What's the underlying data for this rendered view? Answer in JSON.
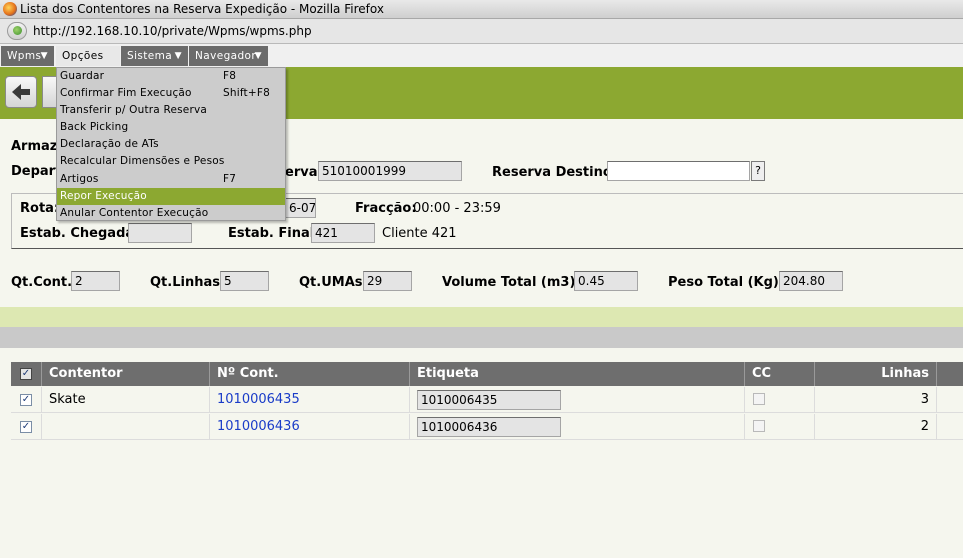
{
  "window": {
    "title": "Lista dos Contentores na Reserva Expedição - Mozilla Firefox",
    "url": "http://192.168.10.10/private/Wpms/wpms.php"
  },
  "menubar": [
    {
      "label": "Wpms"
    },
    {
      "label": "Opções"
    },
    {
      "label": "Sistema"
    },
    {
      "label": "Navegador"
    }
  ],
  "dropdown": [
    {
      "label": "Guardar",
      "shortcut": "F8"
    },
    {
      "label": "Confirmar Fim Execução",
      "shortcut": "Shift+F8"
    },
    {
      "label": "Transferir p/ Outra Reserva",
      "shortcut": ""
    },
    {
      "label": "Back Picking",
      "shortcut": ""
    },
    {
      "label": "Declaração de ATs",
      "shortcut": ""
    },
    {
      "label": "Recalcular Dimensões e Pesos",
      "shortcut": ""
    },
    {
      "label": "Artigos",
      "shortcut": "F7"
    },
    {
      "label": "Repor Execução",
      "shortcut": ""
    },
    {
      "label": "Anular Contentor Execução",
      "shortcut": ""
    }
  ],
  "form": {
    "armazem_label": "Armazé",
    "depart_label": "Depart",
    "reserva_label": "erva:",
    "reserva_value": "51010001999",
    "reserva_destino_label": "Reserva Destino:",
    "reserva_destino_value": "",
    "lookup_label": "?",
    "rota_label": "Rota:",
    "rota_date_value": "6-07",
    "fraccao_label": "Fracção:",
    "fraccao_value": "00:00 - 23:59",
    "estab_chegada_label": "Estab. Chegada:",
    "estab_chegada_value": "",
    "estab_final_label": "Estab. Final:",
    "estab_final_value": "421",
    "estab_final_name": "Cliente 421"
  },
  "totals": {
    "qt_cont_label": "Qt.Cont.:",
    "qt_cont_value": "2",
    "qt_linhas_label": "Qt.Linhas:",
    "qt_linhas_value": "5",
    "qt_umas_label": "Qt.UMAs:",
    "qt_umas_value": "29",
    "volume_label": "Volume Total (m3):",
    "volume_value": "0.45",
    "peso_label": "Peso Total (Kg):",
    "peso_value": "204.80"
  },
  "table": {
    "headers": {
      "contentor": "Contentor",
      "n_cont": "Nº Cont.",
      "etiqueta": "Etiqueta",
      "cc": "CC",
      "linhas": "Linhas"
    },
    "rows": [
      {
        "contentor": "Skate",
        "n_cont": "1010006435",
        "etiqueta": "1010006435",
        "linhas": "3"
      },
      {
        "contentor": "",
        "n_cont": "1010006436",
        "etiqueta": "1010006436",
        "linhas": "2"
      }
    ]
  }
}
